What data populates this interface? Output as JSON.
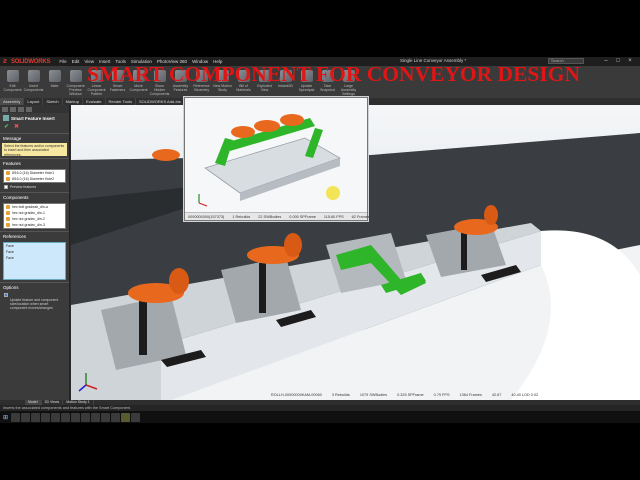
{
  "app": {
    "logo_text": "SOLIDWORKS",
    "menus": [
      "File",
      "Edit",
      "View",
      "Insert",
      "Tools",
      "Simulation",
      "PhotoView 360",
      "Window",
      "Help"
    ],
    "doc_title": "Single Line Conveyor Assembly *",
    "search_placeholder": "Search",
    "win_controls": [
      "–",
      "□",
      "×"
    ]
  },
  "ribbon": {
    "buttons": [
      {
        "label": "Edit Component",
        "icon": "edit-component-icon"
      },
      {
        "label": "Insert Components",
        "icon": "insert-components-icon"
      },
      {
        "label": "Mate",
        "icon": "mate-icon"
      },
      {
        "label": "Component Preview Window",
        "icon": "preview-window-icon"
      },
      {
        "label": "Linear Component Pattern",
        "icon": "linear-pattern-icon"
      },
      {
        "label": "Smart Fasteners",
        "icon": "smart-fasteners-icon"
      },
      {
        "label": "Move Component",
        "icon": "move-component-icon"
      },
      {
        "label": "Show Hidden Components",
        "icon": "show-hidden-icon"
      },
      {
        "label": "Assembly Features",
        "icon": "assembly-features-icon"
      },
      {
        "label": "Reference Geometry",
        "icon": "reference-geometry-icon"
      },
      {
        "label": "New Motion Study",
        "icon": "motion-study-icon"
      },
      {
        "label": "Bill of Materials",
        "icon": "bom-icon"
      },
      {
        "label": "Exploded View",
        "icon": "exploded-view-icon"
      },
      {
        "label": "Instant3D",
        "icon": "instant3d-icon"
      },
      {
        "label": "Update Speedpak",
        "icon": "speedpak-icon"
      },
      {
        "label": "Take Snapshot",
        "icon": "snapshot-icon"
      },
      {
        "label": "Large Assembly Settings",
        "icon": "large-assembly-icon"
      }
    ]
  },
  "command_tabs": [
    "Assembly",
    "Layout",
    "Sketch",
    "Markup",
    "Evaluate",
    "Render Tools",
    "SOLIDWORKS Add-Ins",
    "Simulation",
    "MBD"
  ],
  "property_manager": {
    "title": "Smart Feature Insert",
    "message_header": "Message",
    "message_text": "Select the features and/or components to insert and then associated references.",
    "features_header": "Features",
    "features": [
      "Ø16.0 (16) Diameter Hole1",
      "Ø16.0 (16) Diameter Hole2"
    ],
    "preview_features": "Preview features",
    "components_header": "Components",
    "components": [
      "hex bolt gradeab_din-a",
      "hex nut gradec_din-1",
      "hex nut gradec_din-2",
      "hex nut gradec_din-3"
    ],
    "references_header": "References",
    "references": [
      "Face",
      "Face",
      "Face"
    ],
    "options_header": "Options",
    "options_text": "Update feature and component size/location when smart component moves/changes"
  },
  "overlay_title": "SMART COMPONENT FOR CONVEYOR DESIGN",
  "inset": {
    "status": [
      "0000000000(157373)",
      "1 Rebuilds",
      "22 SWBodies",
      "0.000 SPFrame",
      "115.60 FPS",
      "62 Frames"
    ]
  },
  "viewport_status": [
    "ROLLH-00000000KAM-00060",
    "3 Rebuilds",
    "1079 SWBodies",
    "0.325 SPFrame",
    "0.79 FPS",
    "1364 Frames",
    "42.67",
    "40.40 LOD 0.02"
  ],
  "model_tabs": [
    "Model",
    "3D Views",
    "Motion Study 1"
  ],
  "status_bar": "Inserts the associated components and features with the Smart Component.",
  "taskbar_icons": [
    "windows-start-icon",
    "search-icon",
    "task-view-icon",
    "file-explorer-icon",
    "store-icon",
    "mail-icon",
    "browser-icon",
    "photos-icon",
    "settings-icon",
    "solidworks-icon",
    "folder-icon",
    "app-icon",
    "solidworks-icon-2",
    "record-icon"
  ],
  "colors": {
    "overlay_title": "#e01515",
    "roller": "#e8691e",
    "bracket_black": "#1c1c1c",
    "bracket_green": "#2fb52a",
    "frame": "#c7ccd2"
  }
}
